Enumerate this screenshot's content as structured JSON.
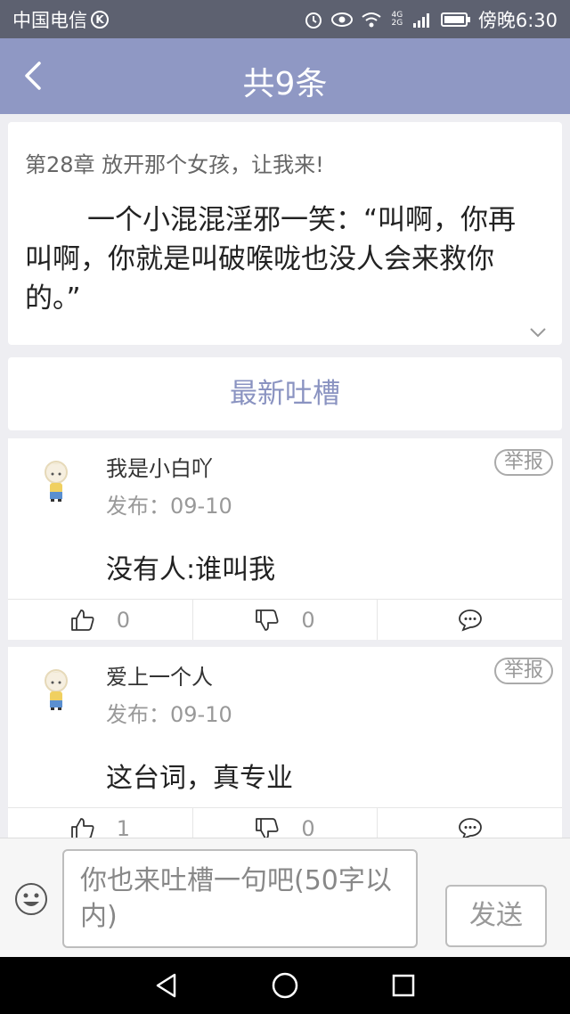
{
  "status_bar": {
    "carrier": "中国电信",
    "carrier_badge": "K",
    "time": "傍晚6:30",
    "network": "4G 2G"
  },
  "header": {
    "title": "共9条"
  },
  "chapter": {
    "title": "第28章 放开那个女孩，让我来!",
    "excerpt": "一个小混混淫邪一笑：“叫啊，你再叫啊，你就是叫破喉咙也没人会来救你的。”"
  },
  "section": {
    "title": "最新吐槽"
  },
  "comments": [
    {
      "user": "我是小白吖",
      "date": "发布：09-10",
      "report": "举报",
      "content": "没有人:谁叫我",
      "likes": "0",
      "dislikes": "0"
    },
    {
      "user": "爱上一个人",
      "date": "发布：09-10",
      "report": "举报",
      "content": "这台词，真专业",
      "likes": "1",
      "dislikes": "0"
    }
  ],
  "composer": {
    "placeholder": "你也来吐槽一句吧(50字以内)",
    "send_label": "发送"
  },
  "colors": {
    "accent": "#8f98c4",
    "statusbar": "#5d6170"
  }
}
